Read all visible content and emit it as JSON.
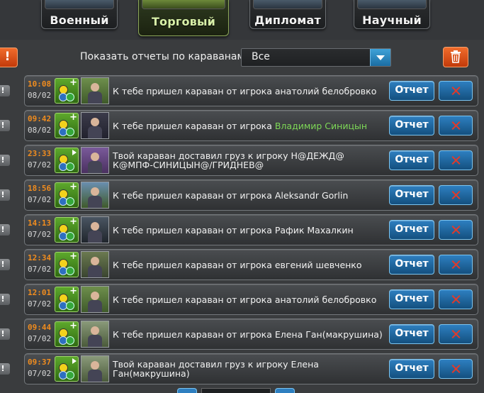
{
  "tabs": [
    {
      "label": "Военный",
      "active": false
    },
    {
      "label": "Торговый",
      "active": true
    },
    {
      "label": "Дипломат",
      "active": false
    },
    {
      "label": "Научный",
      "active": false
    }
  ],
  "filter": {
    "warn_icon": "!",
    "label": "Показать отчеты по караванам:",
    "selected": "Все",
    "trash_icon": "trash-icon"
  },
  "rows": [
    {
      "time": "10:08",
      "date": "08/02",
      "text": "К тебе пришел караван от игрока анатолий белобровко",
      "name": "",
      "icon": "caravan-in"
    },
    {
      "time": "09:42",
      "date": "08/02",
      "text": "К тебе пришел караван от игрока ",
      "name": "Владимир Синицын",
      "icon": "caravan-in"
    },
    {
      "time": "23:33",
      "date": "07/02",
      "text": "Твой караван доставил груз к игроку Н@ДЕЖД@ К@МПФ-СИНИЦЫН@/ГРИДНЕВ@",
      "name": "",
      "icon": "caravan-out"
    },
    {
      "time": "18:56",
      "date": "07/02",
      "text": "К тебе пришел караван от игрока Aleksandr Gorlin",
      "name": "",
      "icon": "caravan-in"
    },
    {
      "time": "14:13",
      "date": "07/02",
      "text": "К тебе пришел караван от игрока Рафик Махалкин",
      "name": "",
      "icon": "caravan-in"
    },
    {
      "time": "12:34",
      "date": "07/02",
      "text": "К тебе пришел караван от игрока евгений шевченко",
      "name": "",
      "icon": "caravan-in"
    },
    {
      "time": "12:01",
      "date": "07/02",
      "text": "К тебе пришел караван от игрока анатолий белобровко",
      "name": "",
      "icon": "caravan-in"
    },
    {
      "time": "09:44",
      "date": "07/02",
      "text": "К тебе пришел караван от игрока Елена Ган(макрушина)",
      "name": "",
      "icon": "caravan-in"
    },
    {
      "time": "09:37",
      "date": "07/02",
      "text": "Твой караван доставил груз к игроку Елена Ган(макрушина)",
      "name": "",
      "icon": "caravan-out"
    }
  ],
  "buttons": {
    "report": "Отчет"
  },
  "colors": {
    "time": "#f08c1e",
    "player_highlight": "#7ed957",
    "button_blue": "#2e7fc0",
    "delete_x": "#e23a2a"
  }
}
